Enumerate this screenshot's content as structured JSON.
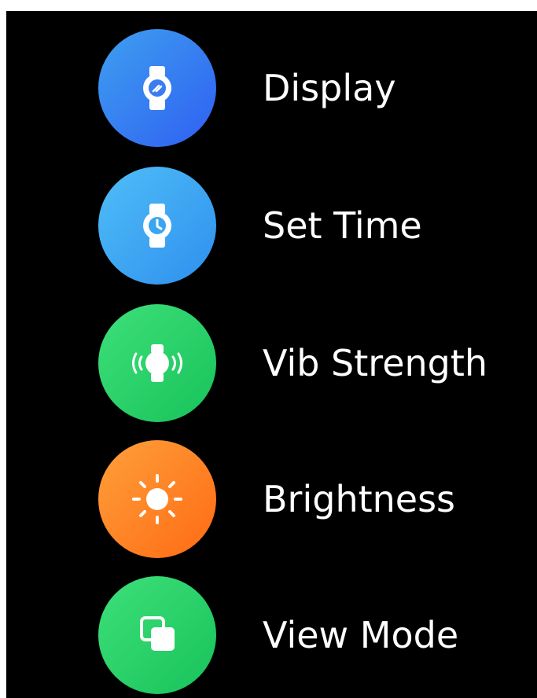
{
  "menu": {
    "items": [
      {
        "label": "Display",
        "icon": "watch-face-icon",
        "color_from": "#3ea0f0",
        "color_to": "#2f5ff2"
      },
      {
        "label": "Set Time",
        "icon": "watch-clock-icon",
        "color_from": "#4fbef7",
        "color_to": "#2f8fee"
      },
      {
        "label": "Vib Strength",
        "icon": "watch-vibration-icon",
        "color_from": "#3ee07a",
        "color_to": "#18c25a"
      },
      {
        "label": "Brightness",
        "icon": "sun-icon",
        "color_from": "#ffa03a",
        "color_to": "#ff6a14"
      },
      {
        "label": "View Mode",
        "icon": "view-mode-icon",
        "color_from": "#3ee07a",
        "color_to": "#18c25a"
      }
    ]
  }
}
